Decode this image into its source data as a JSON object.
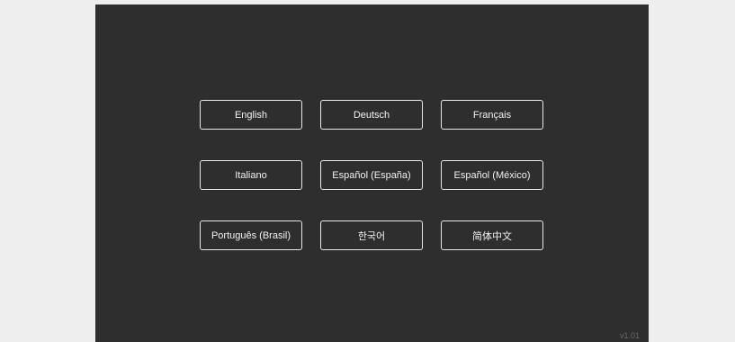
{
  "language_select": {
    "options": [
      {
        "label": "English"
      },
      {
        "label": "Deutsch"
      },
      {
        "label": "Français"
      },
      {
        "label": "Italiano"
      },
      {
        "label": "Español (España)"
      },
      {
        "label": "Español (México)"
      },
      {
        "label": "Português (Brasil)"
      },
      {
        "label": "한국어"
      },
      {
        "label": "简体中文"
      }
    ]
  },
  "footer": {
    "version": "v1.01"
  },
  "colors": {
    "page_background": "#eeeeee",
    "panel_background": "#2e2e2e",
    "button_border": "#e8e8e8",
    "button_text": "#f2f2f2",
    "version_text": "#6a6a6a"
  }
}
